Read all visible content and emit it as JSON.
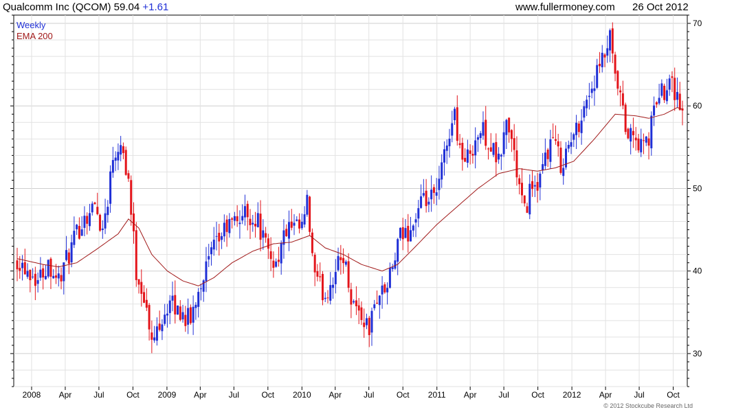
{
  "header": {
    "title": "Qualcomm Inc (QCOM) 59.04",
    "change": "+1.61",
    "website": "www.fullermoney.com",
    "date": "26 Oct 2012"
  },
  "footer": {
    "copyright": "© 2012 Stockcube Research Ltd"
  },
  "colors": {
    "up": "#1f2fd6",
    "down": "#e3141a",
    "ema": "#a01818",
    "grid": "#e2e2e2",
    "axis": "#000000"
  },
  "chart_data": {
    "type": "candlestick",
    "title": "Qualcomm Inc (QCOM) 59.04 +1.61",
    "legend": [
      {
        "label": "Weekly",
        "color": "#1f2fd6"
      },
      {
        "label": "EMA 200",
        "color": "#a01818"
      }
    ],
    "ylim": [
      26,
      71
    ],
    "y_ticks": [
      30,
      40,
      50,
      60,
      70
    ],
    "x_start": "2007-11-23",
    "x_end": "2012-10-26",
    "x_ticks": [
      {
        "label": "2008",
        "date": "2008-01-01"
      },
      {
        "label": "Apr",
        "date": "2008-04-01"
      },
      {
        "label": "Jul",
        "date": "2008-07-01"
      },
      {
        "label": "Oct",
        "date": "2008-10-01"
      },
      {
        "label": "2009",
        "date": "2009-01-01"
      },
      {
        "label": "Apr",
        "date": "2009-04-01"
      },
      {
        "label": "Jul",
        "date": "2009-07-01"
      },
      {
        "label": "Oct",
        "date": "2009-10-01"
      },
      {
        "label": "2010",
        "date": "2010-01-01"
      },
      {
        "label": "Apr",
        "date": "2010-04-01"
      },
      {
        "label": "Jul",
        "date": "2010-07-01"
      },
      {
        "label": "Oct",
        "date": "2010-10-01"
      },
      {
        "label": "2011",
        "date": "2011-01-01"
      },
      {
        "label": "Apr",
        "date": "2011-04-01"
      },
      {
        "label": "Jul",
        "date": "2011-07-01"
      },
      {
        "label": "Oct",
        "date": "2011-10-01"
      },
      {
        "label": "2012",
        "date": "2012-01-01"
      },
      {
        "label": "Apr",
        "date": "2012-04-01"
      },
      {
        "label": "Jul",
        "date": "2012-07-01"
      },
      {
        "label": "Oct",
        "date": "2012-10-01"
      }
    ],
    "close_anchors": [
      [
        "2007-11-23",
        41.5
      ],
      [
        "2008-01-18",
        39
      ],
      [
        "2008-02-15",
        41
      ],
      [
        "2008-03-14",
        39
      ],
      [
        "2008-04-11",
        42
      ],
      [
        "2008-05-16",
        46
      ],
      [
        "2008-06-20",
        48
      ],
      [
        "2008-07-11",
        45
      ],
      [
        "2008-07-25",
        49
      ],
      [
        "2008-08-08",
        54
      ],
      [
        "2008-08-29",
        56
      ],
      [
        "2008-09-19",
        51
      ],
      [
        "2008-10-10",
        40
      ],
      [
        "2008-10-31",
        37
      ],
      [
        "2008-11-21",
        31
      ],
      [
        "2008-12-12",
        34
      ],
      [
        "2009-01-09",
        36
      ],
      [
        "2009-02-06",
        35
      ],
      [
        "2009-03-06",
        34
      ],
      [
        "2009-03-27",
        38
      ],
      [
        "2009-05-01",
        42
      ],
      [
        "2009-06-05",
        45
      ],
      [
        "2009-07-03",
        46
      ],
      [
        "2009-07-31",
        47
      ],
      [
        "2009-09-04",
        46
      ],
      [
        "2009-10-02",
        42
      ],
      [
        "2009-10-23",
        41
      ],
      [
        "2009-11-20",
        45
      ],
      [
        "2009-12-31",
        45
      ],
      [
        "2010-01-15",
        48
      ],
      [
        "2010-01-29",
        42
      ],
      [
        "2010-02-05",
        39
      ],
      [
        "2010-03-05",
        37
      ],
      [
        "2010-04-01",
        40
      ],
      [
        "2010-04-23",
        42
      ],
      [
        "2010-05-14",
        37
      ],
      [
        "2010-06-04",
        35
      ],
      [
        "2010-07-02",
        33
      ],
      [
        "2010-07-23",
        37
      ],
      [
        "2010-08-20",
        38
      ],
      [
        "2010-09-24",
        44
      ],
      [
        "2010-10-22",
        45
      ],
      [
        "2010-11-19",
        48
      ],
      [
        "2010-12-31",
        49
      ],
      [
        "2011-01-21",
        54
      ],
      [
        "2011-02-04",
        57
      ],
      [
        "2011-02-18",
        59
      ],
      [
        "2011-03-04",
        55
      ],
      [
        "2011-03-18",
        53
      ],
      [
        "2011-04-15",
        56
      ],
      [
        "2011-05-06",
        57
      ],
      [
        "2011-05-27",
        55
      ],
      [
        "2011-06-17",
        53
      ],
      [
        "2011-07-08",
        58
      ],
      [
        "2011-07-22",
        56
      ],
      [
        "2011-08-12",
        50
      ],
      [
        "2011-08-26",
        47
      ],
      [
        "2011-09-16",
        51
      ],
      [
        "2011-09-30",
        49
      ],
      [
        "2011-10-21",
        54
      ],
      [
        "2011-11-11",
        56
      ],
      [
        "2011-12-02",
        53
      ],
      [
        "2011-12-23",
        55
      ],
      [
        "2012-01-13",
        57
      ],
      [
        "2012-02-03",
        60
      ],
      [
        "2012-03-02",
        63
      ],
      [
        "2012-03-30",
        66
      ],
      [
        "2012-04-13",
        68
      ],
      [
        "2012-04-27",
        63
      ],
      [
        "2012-05-11",
        61
      ],
      [
        "2012-05-25",
        57
      ],
      [
        "2012-06-15",
        56
      ],
      [
        "2012-07-06",
        55
      ],
      [
        "2012-07-27",
        56
      ],
      [
        "2012-08-17",
        61
      ],
      [
        "2012-09-07",
        62
      ],
      [
        "2012-09-21",
        64
      ],
      [
        "2012-10-05",
        62
      ],
      [
        "2012-10-19",
        60
      ],
      [
        "2012-10-26",
        59.04
      ]
    ],
    "ema200_anchors": [
      [
        "2007-11-23",
        41.5
      ],
      [
        "2008-02-01",
        40.8
      ],
      [
        "2008-03-14",
        40.5
      ],
      [
        "2008-05-02",
        41
      ],
      [
        "2008-06-27",
        42.7
      ],
      [
        "2008-08-22",
        44.5
      ],
      [
        "2008-09-19",
        46.3
      ],
      [
        "2008-10-17",
        45.2
      ],
      [
        "2008-11-21",
        42
      ],
      [
        "2009-01-02",
        40
      ],
      [
        "2009-02-13",
        38.8
      ],
      [
        "2009-03-27",
        38.2
      ],
      [
        "2009-05-08",
        39.2
      ],
      [
        "2009-06-26",
        41
      ],
      [
        "2009-08-21",
        42.4
      ],
      [
        "2009-10-16",
        43.3
      ],
      [
        "2009-12-04",
        43.5
      ],
      [
        "2010-01-22",
        44.3
      ],
      [
        "2010-03-05",
        42.8
      ],
      [
        "2010-04-23",
        42
      ],
      [
        "2010-06-11",
        40.8
      ],
      [
        "2010-08-06",
        40
      ],
      [
        "2010-09-17",
        40.8
      ],
      [
        "2010-11-05",
        43
      ],
      [
        "2010-12-31",
        45.6
      ],
      [
        "2011-02-25",
        47.8
      ],
      [
        "2011-04-22",
        50
      ],
      [
        "2011-06-17",
        51.8
      ],
      [
        "2011-08-12",
        52.4
      ],
      [
        "2011-09-30",
        52.1
      ],
      [
        "2011-11-18",
        52.5
      ],
      [
        "2012-01-06",
        53.3
      ],
      [
        "2012-03-02",
        56
      ],
      [
        "2012-04-27",
        59
      ],
      [
        "2012-06-22",
        58.8
      ],
      [
        "2012-07-27",
        58.5
      ],
      [
        "2012-09-07",
        59
      ],
      [
        "2012-10-12",
        59.8
      ],
      [
        "2012-10-26",
        59.6
      ]
    ]
  }
}
